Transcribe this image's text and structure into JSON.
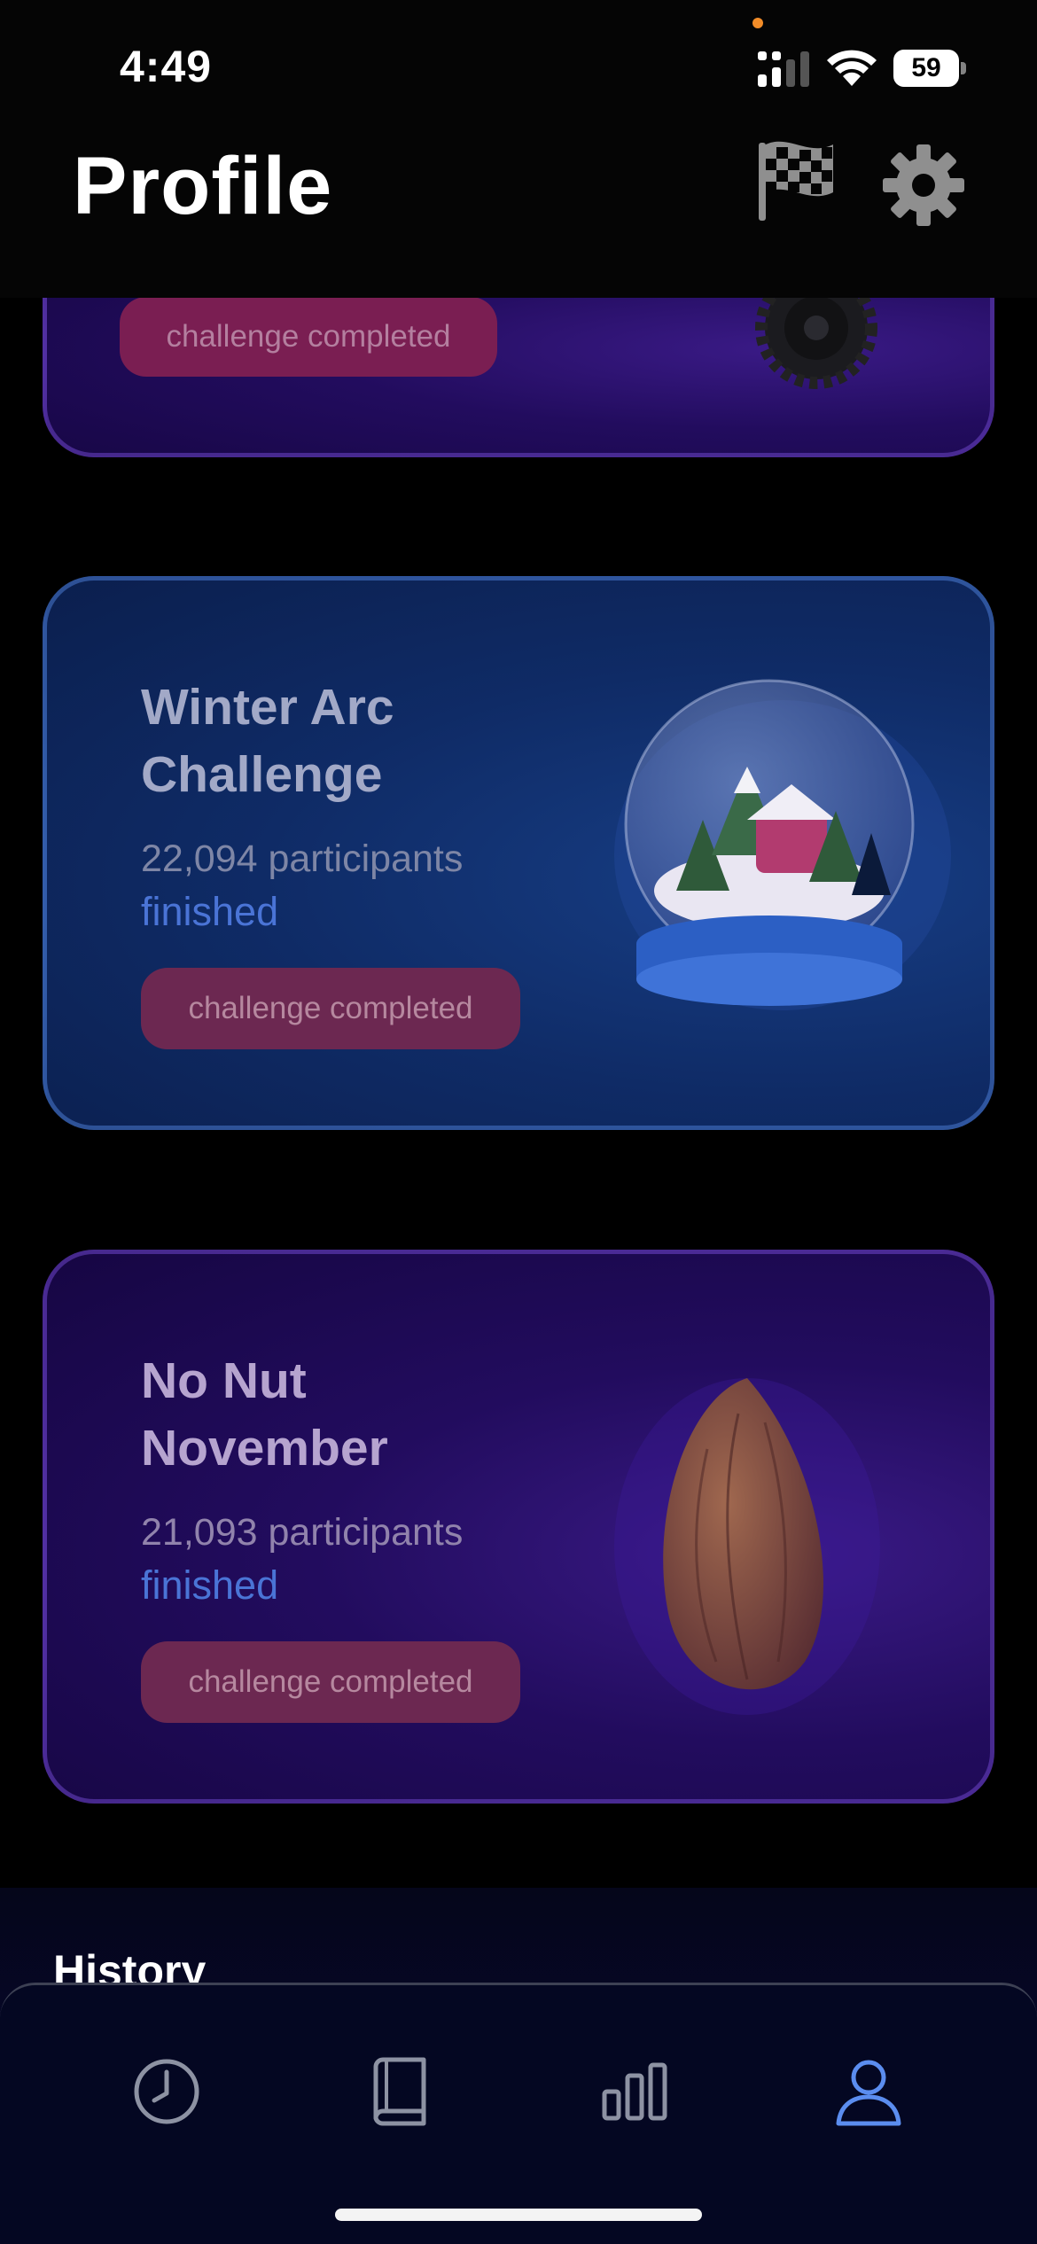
{
  "status_bar": {
    "time": "4:49",
    "battery": "59"
  },
  "header": {
    "title": "Profile"
  },
  "cards": [
    {
      "title": "",
      "participants": "",
      "status": "",
      "button": "challenge completed"
    },
    {
      "title_line1": "Winter Arc",
      "title_line2": "Challenge",
      "participants": "22,094 participants",
      "status": "finished",
      "button": "challenge completed"
    },
    {
      "title_line1": "No Nut",
      "title_line2": "November",
      "participants": "21,093 participants",
      "status": "finished",
      "button": "challenge completed"
    }
  ],
  "history": {
    "title": "History"
  },
  "tabs": [
    {
      "icon": "clock-icon",
      "active": false
    },
    {
      "icon": "book-icon",
      "active": false
    },
    {
      "icon": "bar-chart-icon",
      "active": false
    },
    {
      "icon": "person-icon",
      "active": true
    }
  ],
  "colors": {
    "accent": "#5b8def",
    "inactive_tab": "#8d92a3",
    "pill": "#6c2851"
  }
}
